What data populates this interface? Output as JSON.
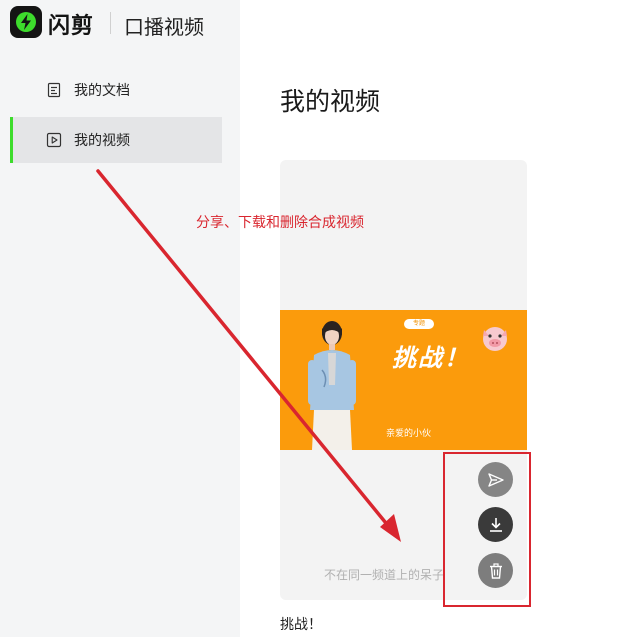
{
  "brand": {
    "name": "闪剪",
    "app_title": "口播视频",
    "logo_icon": "lightning-bolt-icon",
    "accent_color": "#3ddc2c"
  },
  "sidebar": {
    "items": [
      {
        "label": "我的文档",
        "icon": "document-icon",
        "active": false
      },
      {
        "label": "我的视频",
        "icon": "video-play-icon",
        "active": true
      }
    ]
  },
  "main": {
    "title": "我的视频",
    "video_card": {
      "thumbnail": {
        "badge": "专题",
        "headline": "挑战！",
        "subtitle": "亲爱的小伙",
        "background_color": "#fb9b0c",
        "sticker_icon": "pig-face-icon"
      },
      "caption": "不在同一频道上的呆子",
      "name": "挑战！",
      "actions": [
        {
          "label": "share",
          "icon": "send-icon"
        },
        {
          "label": "download",
          "icon": "download-icon"
        },
        {
          "label": "delete",
          "icon": "trash-icon"
        }
      ]
    }
  },
  "annotation": {
    "text": "分享、下载和删除合成视频",
    "color": "#d9262f"
  }
}
